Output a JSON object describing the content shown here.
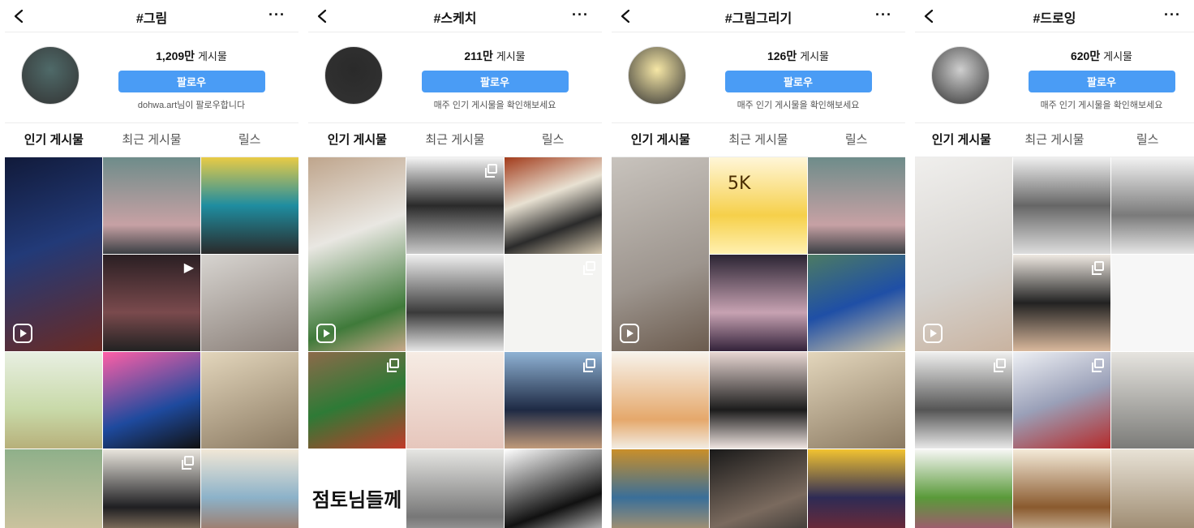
{
  "panels": [
    {
      "title": "#그림",
      "post_count": "1,209만",
      "post_label": "게시물",
      "follow_label": "팔로우",
      "note": "dohwa.art님이 팔로우합니다",
      "tabs": [
        "인기 게시물",
        "최근 게시물",
        "릴스"
      ],
      "avatar_color": "#4f6a69",
      "thumbs": [
        {
          "bg": "linear-gradient(160deg,#111a3a,#223a78 45%,#6b2a23 100%)",
          "tall": true,
          "reels": true
        },
        {
          "bg": "linear-gradient(180deg,#6e8c8a,#c7a1a4 70%,#3b3f44)",
          "overlay": "none"
        },
        {
          "bg": "linear-gradient(180deg,#e9cb45,#1f8da0 50%,#2a2a2a)",
          "overlay": "none"
        },
        {
          "bg": "linear-gradient(180deg,#2a1f23,#7a4a4d 60%,#222)",
          "overlay": "play"
        },
        {
          "bg": "linear-gradient(160deg,#d7d4d0,#8a7f78)",
          "overlay": "none"
        },
        {
          "bg": "linear-gradient(180deg,#e8efe2,#c8d9a8 60%,#b7b07a)",
          "overlay": "none"
        },
        {
          "bg": "linear-gradient(160deg,#ff5fa6,#1e4a9e 60%,#111)",
          "overlay": "none"
        },
        {
          "bg": "linear-gradient(160deg,#e3d6bc,#8b7a62)",
          "overlay": "none"
        },
        {
          "bg": "linear-gradient(180deg,#8fb08a,#d7c6a2)",
          "overlay": "none"
        },
        {
          "bg": "linear-gradient(180deg,#e9e5dd,#1f1f22 60%,#c6a987)",
          "overlay": "multi"
        },
        {
          "bg": "linear-gradient(180deg,#f1e7d6,#8cb2c9 50%,#a6623f)",
          "overlay": "none"
        }
      ]
    },
    {
      "title": "#스케치",
      "post_count": "211만",
      "post_label": "게시물",
      "follow_label": "팔로우",
      "note": "매주 인기 게시물을 확인해보세요",
      "tabs": [
        "인기 게시물",
        "최근 게시물",
        "릴스"
      ],
      "avatar_color": "#2a2a2a",
      "thumbs": [
        {
          "bg": "linear-gradient(160deg,#bfa58c,#e9e7e2 40%,#3f7a3a 80%,#c9a88a)",
          "tall": true,
          "reels": true
        },
        {
          "bg": "linear-gradient(180deg,#f4f4f4,#2a2a2a 50%,#c9c9c9)",
          "overlay": "multi"
        },
        {
          "bg": "linear-gradient(160deg,#a23b1b,#e8e1d2 40%,#2b2b2b 70%,#d6c9b0)",
          "overlay": "none"
        },
        {
          "bg": "linear-gradient(180deg,#efefef,#3a3a3a 60%,#e6e6e6)",
          "overlay": "none"
        },
        {
          "bg": "linear-gradient(180deg,#f4f4f2,#f4f4f2)",
          "overlay": "multi"
        },
        {
          "bg": "linear-gradient(160deg,#8c6a4a,#2e7a36 50%,#c23a2a)",
          "overlay": "multi"
        },
        {
          "bg": "linear-gradient(180deg,#f6ece4,#e6c6bc)",
          "overlay": "none"
        },
        {
          "bg": "linear-gradient(180deg,#8fb2d4,#1e2a44 60%,#c09a7a)",
          "overlay": "multi"
        },
        {
          "bg": "#ffffff",
          "overlay": "multi",
          "text": "점토님들께"
        },
        {
          "bg": "linear-gradient(180deg,#e6e6e3,#777 70%,#bbb)",
          "overlay": "none"
        },
        {
          "bg": "linear-gradient(160deg,#ffffff,#111 60%,#fff)",
          "overlay": "none"
        }
      ]
    },
    {
      "title": "#그림그리기",
      "post_count": "126만",
      "post_label": "게시물",
      "follow_label": "팔로우",
      "note": "매주 인기 게시물을 확인해보세요",
      "tabs": [
        "인기 게시물",
        "최근 게시물",
        "릴스"
      ],
      "avatar_color": "#f6e7a6",
      "thumbs": [
        {
          "bg": "linear-gradient(160deg,#c8c3bd,#9d958e 60%,#6b5b4e)",
          "tall": true,
          "reels": true
        },
        {
          "bg": "linear-gradient(180deg,#fff6d8,#f6d04a 60%,#fff0b0)",
          "overlay": "none",
          "badge": "5K"
        },
        {
          "bg": "linear-gradient(180deg,#6e8c8a,#c7a1a4 70%,#3b3f44)",
          "overlay": "none"
        },
        {
          "bg": "linear-gradient(180deg,#2b2433,#c7a2b2 60%,#33223a)",
          "overlay": "none"
        },
        {
          "bg": "linear-gradient(160deg,#4c7b63,#1f4fa6 50%,#d6c9a6)",
          "overlay": "none"
        },
        {
          "bg": "linear-gradient(180deg,#f7f3ec,#e5a86b 70%,#f2ece2)",
          "overlay": "none"
        },
        {
          "bg": "linear-gradient(180deg,#e7d6d2,#1c1c1c 60%,#efe4e0)",
          "overlay": "none"
        },
        {
          "bg": "linear-gradient(160deg,#e3d6bc,#8b7a62)",
          "overlay": "none"
        },
        {
          "bg": "linear-gradient(180deg,#c98f2a,#3a6f99 50%,#d7a15e)",
          "overlay": "none"
        },
        {
          "bg": "linear-gradient(160deg,#1a1a1a,#7a6a5e 60%,#2a2a2a)",
          "overlay": "none"
        },
        {
          "bg": "linear-gradient(180deg,#f2c331,#2e2b55 50%,#8a2a2a)",
          "overlay": "none"
        }
      ]
    },
    {
      "title": "#드로잉",
      "post_count": "620만",
      "post_label": "게시물",
      "follow_label": "팔로우",
      "note": "매주 인기 게시물을 확인해보세요",
      "tabs": [
        "인기 게시물",
        "최근 게시물",
        "릴스"
      ],
      "avatar_color": "#cfcfcf",
      "thumbs": [
        {
          "bg": "linear-gradient(160deg,#f0efed,#d5d2ce 60%,#c9b3a0)",
          "tall": true,
          "reels": true
        },
        {
          "bg": "linear-gradient(180deg,#efefef,#666 50%,#ddd)",
          "overlay": "none"
        },
        {
          "bg": "linear-gradient(180deg,#f2f2f2,#7a7a7a 60%,#e6e6e6)",
          "overlay": "none"
        },
        {
          "bg": "linear-gradient(180deg,#efe9e2,#222 50%,#d9b89c)",
          "overlay": "multi"
        },
        {
          "bg": "linear-gradient(180deg,#f7f7f7,#f7f7f7)",
          "overlay": "none"
        },
        {
          "bg": "linear-gradient(180deg,#f0f0ef,#555 60%,#e8e8e8)",
          "overlay": "multi"
        },
        {
          "bg": "linear-gradient(160deg,#eef0f4,#9aa0b8 50%,#b52a2a)",
          "overlay": "multi"
        },
        {
          "bg": "linear-gradient(180deg,#e6e4df,#7b7b78)",
          "overlay": "none"
        },
        {
          "bg": "linear-gradient(180deg,#f7f7f5,#5a9a3a 50%,#c23a8a)",
          "overlay": "none"
        },
        {
          "bg": "linear-gradient(180deg,#f4ead8,#8a5a2e 60%,#e9e1d0)",
          "overlay": "none"
        },
        {
          "bg": "linear-gradient(180deg,#e8e2d6,#8f7a5d)",
          "overlay": "none"
        }
      ]
    }
  ]
}
